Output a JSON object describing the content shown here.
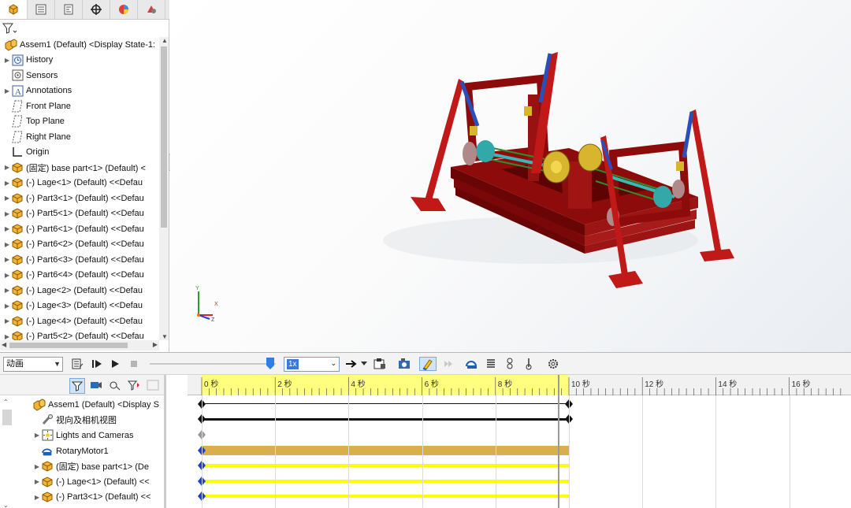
{
  "feature_tree": {
    "tabs": [
      "feature-manager",
      "property-manager",
      "configuration-manager",
      "dimxpert-manager",
      "display-manager",
      "appearances"
    ],
    "items": [
      {
        "label": "Assem1 (Default) <Display State-1:",
        "icon": "assembly-icon",
        "expander": false,
        "indent": 0
      },
      {
        "label": "History",
        "icon": "history-icon",
        "expander": true,
        "indent": 1
      },
      {
        "label": "Sensors",
        "icon": "sensors-icon",
        "expander": false,
        "indent": 1
      },
      {
        "label": "Annotations",
        "icon": "annotations-icon",
        "expander": true,
        "indent": 1
      },
      {
        "label": "Front Plane",
        "icon": "plane-icon",
        "expander": false,
        "indent": 1
      },
      {
        "label": "Top Plane",
        "icon": "plane-icon",
        "expander": false,
        "indent": 1
      },
      {
        "label": "Right Plane",
        "icon": "plane-icon",
        "expander": false,
        "indent": 1
      },
      {
        "label": "Origin",
        "icon": "origin-icon",
        "expander": false,
        "indent": 1
      },
      {
        "label": "(固定) base part<1> (Default) <",
        "icon": "part-icon",
        "expander": true,
        "indent": 1
      },
      {
        "label": "(-) Lage<1> (Default) <<Defau",
        "icon": "part-icon",
        "expander": true,
        "indent": 1
      },
      {
        "label": "(-) Part3<1> (Default) <<Defau",
        "icon": "part-icon",
        "expander": true,
        "indent": 1
      },
      {
        "label": "(-) Part5<1> (Default) <<Defau",
        "icon": "part-icon",
        "expander": true,
        "indent": 1
      },
      {
        "label": "(-) Part6<1> (Default) <<Defau",
        "icon": "part-icon",
        "expander": true,
        "indent": 1
      },
      {
        "label": "(-) Part6<2> (Default) <<Defau",
        "icon": "part-icon",
        "expander": true,
        "indent": 1
      },
      {
        "label": "(-) Part6<3> (Default) <<Defau",
        "icon": "part-icon",
        "expander": true,
        "indent": 1
      },
      {
        "label": "(-) Part6<4> (Default) <<Defau",
        "icon": "part-icon",
        "expander": true,
        "indent": 1
      },
      {
        "label": "(-) Lage<2> (Default) <<Defau",
        "icon": "part-icon",
        "expander": true,
        "indent": 1
      },
      {
        "label": "(-) Lage<3> (Default) <<Defau",
        "icon": "part-icon",
        "expander": true,
        "indent": 1
      },
      {
        "label": "(-) Lage<4> (Default) <<Defau",
        "icon": "part-icon",
        "expander": true,
        "indent": 1
      },
      {
        "label": "(-) Part5<2> (Default) <<Defau",
        "icon": "part-icon",
        "expander": true,
        "indent": 1
      }
    ]
  },
  "triad": {
    "y": "Y",
    "x": "X",
    "z": "Z"
  },
  "motion_manager": {
    "study_type": "动画",
    "playback_speed": "1x",
    "timeline_labels": [
      "0 秒",
      "2 秒",
      "4 秒",
      "6 秒",
      "8 秒",
      "10 秒",
      "12 秒",
      "14 秒",
      "16 秒"
    ],
    "tree_items": [
      {
        "label": "Assem1 (Default) <Display S",
        "icon": "assembly-icon",
        "expander": false,
        "indent": 0
      },
      {
        "label": "视向及相机视图",
        "icon": "camera-view-icon",
        "expander": false,
        "indent": 1
      },
      {
        "label": "Lights and Cameras",
        "icon": "lights-cameras-icon",
        "expander": true,
        "indent": 1
      },
      {
        "label": "RotaryMotor1",
        "icon": "rotary-motor-icon",
        "expander": false,
        "indent": 1
      },
      {
        "label": "(固定) base part<1> (De",
        "icon": "part-icon",
        "expander": true,
        "indent": 1
      },
      {
        "label": "(-) Lage<1> (Default) <<",
        "icon": "part-icon",
        "expander": true,
        "indent": 1
      },
      {
        "label": "(-) Part3<1> (Default) <<",
        "icon": "part-icon",
        "expander": true,
        "indent": 1
      }
    ],
    "timeline_end_seconds": 10,
    "timeline_visible_seconds": 17.5,
    "colors": {
      "ruler_active": "#ffff7f",
      "motor_bar": "#d8ae4f",
      "part_bar": "#ffff00",
      "key_blue": "#1f3fd0",
      "key_black": "#111111"
    }
  }
}
